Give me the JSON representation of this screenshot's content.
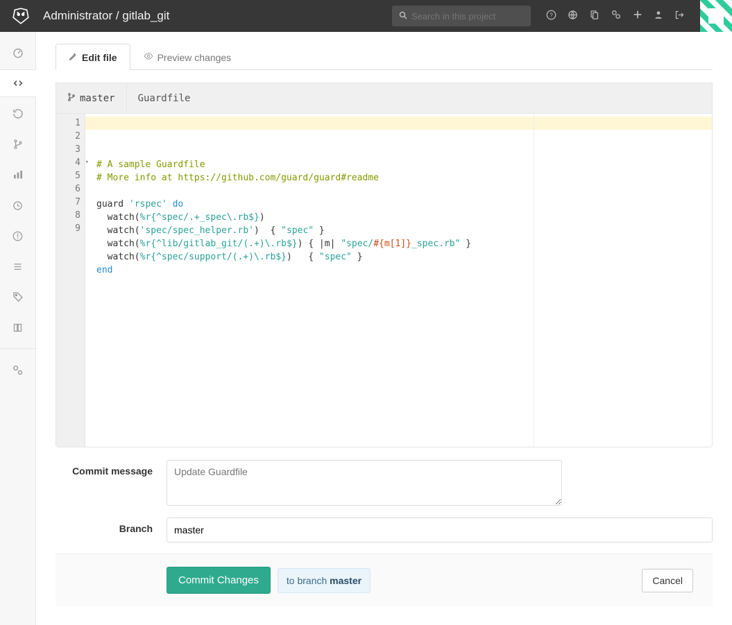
{
  "header": {
    "title": "Administrator / gitlab_git",
    "search_placeholder": "Search in this project"
  },
  "tabs": {
    "edit": "Edit file",
    "preview": "Preview changes"
  },
  "editor": {
    "branch": "master",
    "filename": "Guardfile",
    "lines": [
      {
        "n": 1,
        "fold": true,
        "segments": [
          {
            "t": "# A sample Guardfile",
            "c": "tok-comment"
          }
        ]
      },
      {
        "n": 2,
        "segments": [
          {
            "t": "# More info at https://github.com/guard/guard#readme",
            "c": "tok-comment"
          }
        ]
      },
      {
        "n": 3,
        "segments": [
          {
            "t": ""
          }
        ]
      },
      {
        "n": 4,
        "fold": true,
        "segments": [
          {
            "t": "guard ",
            "c": ""
          },
          {
            "t": "'rspec'",
            "c": "tok-str"
          },
          {
            "t": " ",
            "c": ""
          },
          {
            "t": "do",
            "c": "tok-kw"
          }
        ]
      },
      {
        "n": 5,
        "segments": [
          {
            "t": "  watch(",
            "c": ""
          },
          {
            "t": "%r{^spec/.+_spec\\.rb$}",
            "c": "tok-re"
          },
          {
            "t": ")",
            "c": ""
          }
        ]
      },
      {
        "n": 6,
        "segments": [
          {
            "t": "  watch(",
            "c": ""
          },
          {
            "t": "'spec/spec_helper.rb'",
            "c": "tok-str"
          },
          {
            "t": ")  { ",
            "c": ""
          },
          {
            "t": "\"spec\"",
            "c": "tok-str"
          },
          {
            "t": " }",
            "c": ""
          }
        ]
      },
      {
        "n": 7,
        "segments": [
          {
            "t": "  watch(",
            "c": ""
          },
          {
            "t": "%r{^lib/gitlab_git/(.+)\\.rb$}",
            "c": "tok-re"
          },
          {
            "t": ") { |m| ",
            "c": ""
          },
          {
            "t": "\"spec/",
            "c": "tok-str"
          },
          {
            "t": "#{m[1]}",
            "c": "tok-interp"
          },
          {
            "t": "_spec.rb\"",
            "c": "tok-str"
          },
          {
            "t": " }",
            "c": ""
          }
        ]
      },
      {
        "n": 8,
        "segments": [
          {
            "t": "  watch(",
            "c": ""
          },
          {
            "t": "%r{^spec/support/(.+)\\.rb$}",
            "c": "tok-re"
          },
          {
            "t": ")   { ",
            "c": ""
          },
          {
            "t": "\"spec\"",
            "c": "tok-str"
          },
          {
            "t": " }",
            "c": ""
          }
        ]
      },
      {
        "n": 9,
        "segments": [
          {
            "t": "end",
            "c": "tok-kw"
          }
        ]
      }
    ]
  },
  "form": {
    "commit_label": "Commit message",
    "commit_placeholder": "Update Guardfile",
    "branch_label": "Branch",
    "branch_value": "master"
  },
  "actions": {
    "commit": "Commit Changes",
    "hint_prefix": "to branch ",
    "hint_branch": "master",
    "cancel": "Cancel"
  },
  "sidebar_icons": [
    "dashboard",
    "code",
    "history",
    "branch",
    "graph",
    "clock",
    "issue",
    "list",
    "tag",
    "book",
    "settings"
  ]
}
